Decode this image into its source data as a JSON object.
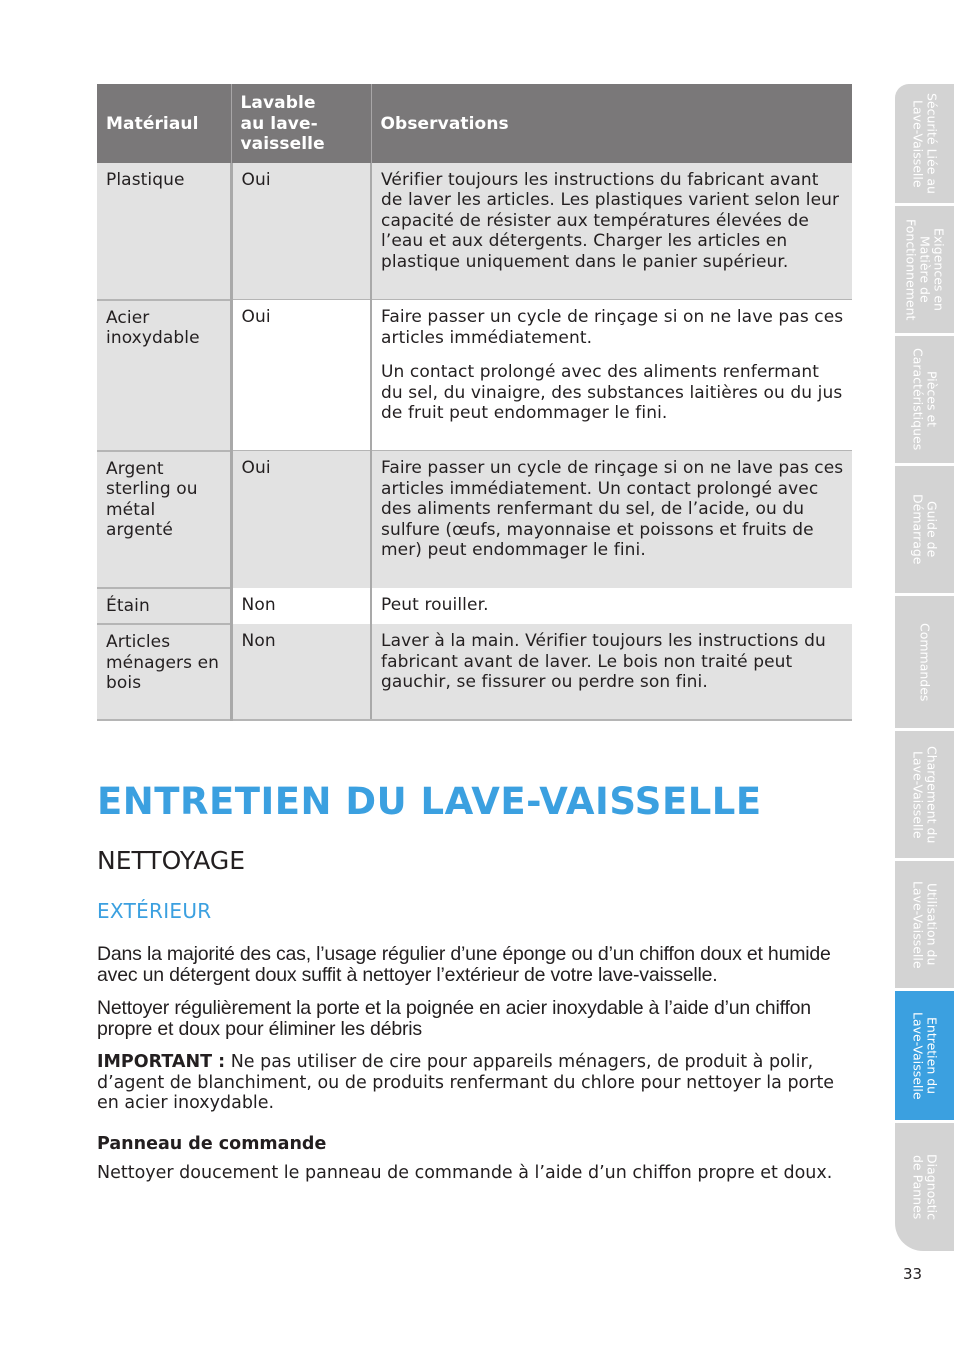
{
  "table": {
    "headers": [
      "Matériaul",
      "Lavable\nau lave-\nvaisselle",
      "Observations"
    ],
    "rows": [
      {
        "material": "Plastique",
        "washable": "Oui",
        "observations": [
          "Vérifier toujours les instructions du fabricant avant de laver les articles. Les plastiques varient selon leur capacité de résister aux températures élevées de l’eau et aux détergents. Charger les articles en plastique uniquement dans le panier supérieur."
        ]
      },
      {
        "material": "Acier inoxydable",
        "washable": "Oui",
        "observations": [
          "Faire passer un cycle de rinçage si on ne lave pas ces articles immédiatement.",
          "Un contact prolongé avec des aliments renfermant du sel, du vinaigre, des substances laitières ou du jus de fruit peut endommager le fini."
        ]
      },
      {
        "material": "Argent sterling ou métal argenté",
        "washable": "Oui",
        "observations": [
          "Faire passer un cycle de rinçage si on ne lave pas ces articles immédiatement. Un contact prolongé avec des aliments renfermant du sel, de l’acide, ou du sulfure (œufs, mayonnaise et poissons et fruits de mer) peut endommager le fini."
        ]
      },
      {
        "material": "Étain",
        "washable": "Non",
        "observations": [
          "Peut rouiller."
        ]
      },
      {
        "material": "Articles ménagers en bois",
        "washable": "Non",
        "observations": [
          "Laver à la main. Vérifier toujours les instructions du fabricant avant de laver. Le bois non traité peut gauchir, se fissurer ou perdre son fini."
        ]
      }
    ]
  },
  "section": {
    "title": "ENTRETIEN DU LAVE-VAISSELLE",
    "subtitle": "NETTOYAGE",
    "subsection": "EXTÉRIEUR",
    "paragraph1": "Dans la majorité des cas, l’usage régulier d’une éponge ou d’un chiffon doux et humide avec un détergent doux suffit à nettoyer l’extérieur de votre lave-vaisselle.",
    "paragraph2": "Nettoyer régulièrement la porte et la poignée en acier inoxydable à l’aide d’un chiffon propre et doux pour éliminer les débris",
    "important_label": "IMPORTANT :",
    "important_text": " Ne pas utiliser de cire pour appareils ménagers, de produit à polir, d’agent de blanchiment, ou de produits renfermant du chlore pour nettoyer la porte en acier inoxydable.",
    "panel_heading": "Panneau de commande",
    "panel_text": "Nettoyer doucement le panneau de commande à l’aide d’un chiffon propre et doux."
  },
  "side_tabs": [
    {
      "label": "Sécurité Liée au\nLave-Vaisselle",
      "active": false
    },
    {
      "label": "Exigences en\nMatière de\nFonctionnement",
      "active": false
    },
    {
      "label": "Pièces et\nCaractéristiques",
      "active": false
    },
    {
      "label": "Guide de\nDémarrage",
      "active": false
    },
    {
      "label": "Commandes",
      "active": false
    },
    {
      "label": "Chargement du\nLave-Vaisselle",
      "active": false
    },
    {
      "label": "Utilisation du\nLave-Vaisselle",
      "active": false
    },
    {
      "label": "Entretien du\nLave-Vaisselle",
      "active": true
    },
    {
      "label": "Diagnostic\nde Pannes",
      "active": false
    }
  ],
  "colors": {
    "accent_blue": "#3ba0e0",
    "header_gray": "#7a7879",
    "row_shade": "#e2e2e2",
    "tab_gray": "#d3d3d3"
  },
  "page_number": "33"
}
